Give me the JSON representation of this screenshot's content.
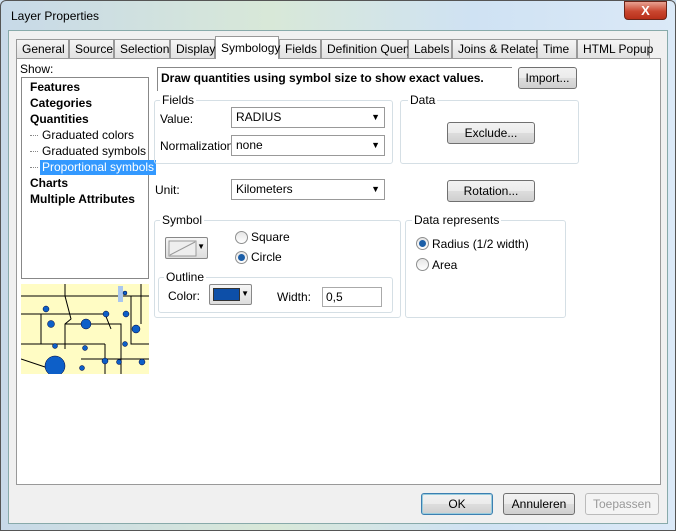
{
  "window": {
    "title": "Layer Properties",
    "close": "X"
  },
  "tabs": [
    "General",
    "Source",
    "Selection",
    "Display",
    "Symbology",
    "Fields",
    "Definition Query",
    "Labels",
    "Joins & Relates",
    "Time",
    "HTML Popup"
  ],
  "show": {
    "label": "Show:",
    "items": [
      {
        "label": "Features",
        "level": 0
      },
      {
        "label": "Categories",
        "level": 0
      },
      {
        "label": "Quantities",
        "level": 0
      },
      {
        "label": "Graduated colors",
        "level": 1
      },
      {
        "label": "Graduated symbols",
        "level": 1
      },
      {
        "label": "Proportional symbols",
        "level": 1,
        "selected": true
      },
      {
        "label": "Charts",
        "level": 0
      },
      {
        "label": "Multiple Attributes",
        "level": 0
      }
    ]
  },
  "description": "Draw quantities using symbol size to show exact values.",
  "import": "Import...",
  "fields": {
    "title": "Fields",
    "value_label": "Value:",
    "value": "RADIUS",
    "norm_label": "Normalization:",
    "norm": "none"
  },
  "data": {
    "title": "Data",
    "exclude": "Exclude..."
  },
  "unit": {
    "label": "Unit:",
    "value": "Kilometers"
  },
  "rotation": "Rotation...",
  "symbol": {
    "title": "Symbol",
    "square": "Square",
    "circle": "Circle",
    "selected": "Circle",
    "outline": {
      "title": "Outline",
      "color_label": "Color:",
      "color": "#0d4fa8",
      "width_label": "Width:",
      "width": "0,5"
    }
  },
  "represents": {
    "title": "Data represents",
    "radius": "Radius (1/2 width)",
    "area": "Area",
    "selected": "Radius"
  },
  "buttons": {
    "ok": "OK",
    "cancel": "Annuleren",
    "apply": "Toepassen"
  }
}
